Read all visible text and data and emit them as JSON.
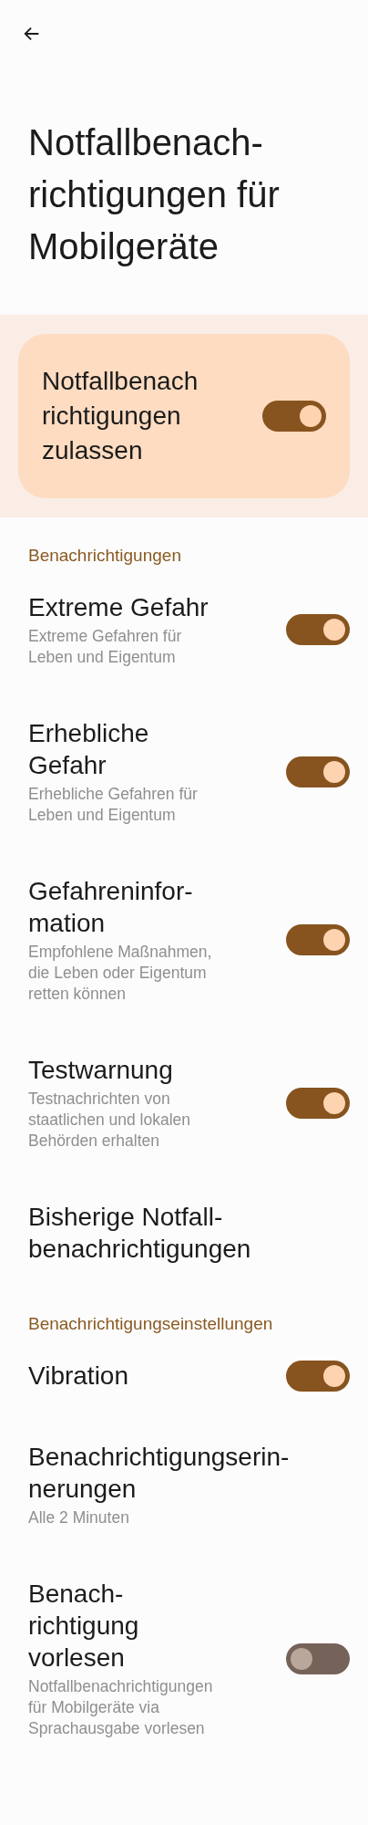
{
  "title": "Notfallbenach-\nrichtigungen für\nMobilgeräte",
  "master": {
    "label": "Notfallbenach\nrichtigungen\nzulassen",
    "on": true
  },
  "sections": [
    {
      "header": "Benachrichtigungen",
      "items": [
        {
          "kind": "toggle",
          "title": "Extreme Gefahr",
          "subtitle": "Extreme Gefahren für\nLeben und Eigentum",
          "on": true
        },
        {
          "kind": "toggle",
          "title": "Erhebliche\nGefahr",
          "subtitle": "Erhebliche Gefahren für\nLeben und Eigentum",
          "on": true
        },
        {
          "kind": "toggle",
          "title": "Gefahreninfor-\nmation",
          "subtitle": "Empfohlene Maßnahmen,\ndie Leben oder Eigentum\nretten können",
          "on": true
        },
        {
          "kind": "toggle",
          "title": "Testwarnung",
          "subtitle": "Testnachrichten von\nstaatlichen und lokalen\nBehörden erhalten",
          "on": true
        },
        {
          "kind": "link",
          "title": "Bisherige Notfall-\nbenachrichtigungen"
        }
      ]
    },
    {
      "header": "Benachrichtigungseinstellungen",
      "items": [
        {
          "kind": "toggle",
          "title": "Vibration",
          "on": true
        },
        {
          "kind": "link",
          "title": "Benachrichtigungserin-\nnerungen",
          "subtitle": "Alle 2 Minuten"
        },
        {
          "kind": "toggle",
          "title": "Benach-\nrichtigung\nvorlesen",
          "subtitle": "Notfallbenachrichtigungen\nfür Mobilgeräte via\nSprachausgabe vorlesen",
          "on": false
        }
      ]
    }
  ]
}
